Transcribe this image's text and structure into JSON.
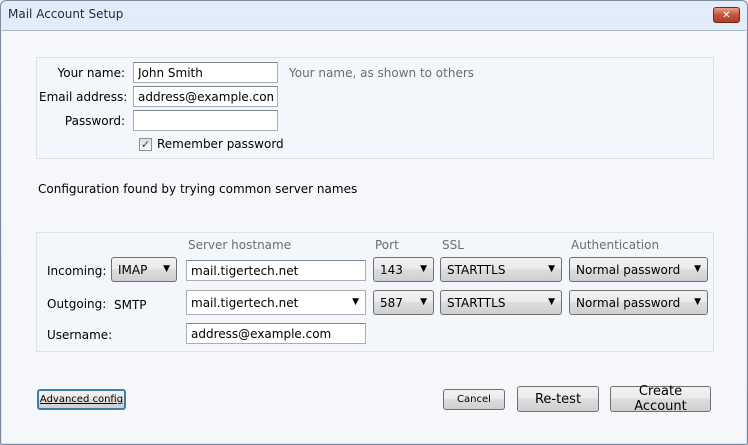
{
  "window": {
    "title": "Mail Account Setup",
    "close_glyph": "✕"
  },
  "identity": {
    "name_label": "Your name:",
    "name_value": "John Smith",
    "name_hint": "Your name, as shown to others",
    "email_label": "Email address:",
    "email_value": "address@example.com",
    "password_label": "Password:",
    "password_value": "",
    "remember_label": "Remember password",
    "remember_checked": true,
    "check_glyph": "✓"
  },
  "status_message": "Configuration found by trying common server names",
  "server": {
    "headers": {
      "hostname": "Server hostname",
      "port": "Port",
      "ssl": "SSL",
      "auth": "Authentication"
    },
    "incoming": {
      "label": "Incoming:",
      "protocol": "IMAP",
      "hostname": "mail.tigertech.net",
      "port": "143",
      "ssl": "STARTTLS",
      "auth": "Normal password"
    },
    "outgoing": {
      "label": "Outgoing:",
      "protocol": "SMTP",
      "hostname": "mail.tigertech.net",
      "port": "587",
      "ssl": "STARTTLS",
      "auth": "Normal password"
    },
    "username_label": "Username:",
    "username_value": "address@example.com"
  },
  "buttons": {
    "advanced": "Advanced config",
    "cancel": "Cancel",
    "retest": "Re-test",
    "create": "Create Account"
  },
  "dropdown_glyph": "▼"
}
